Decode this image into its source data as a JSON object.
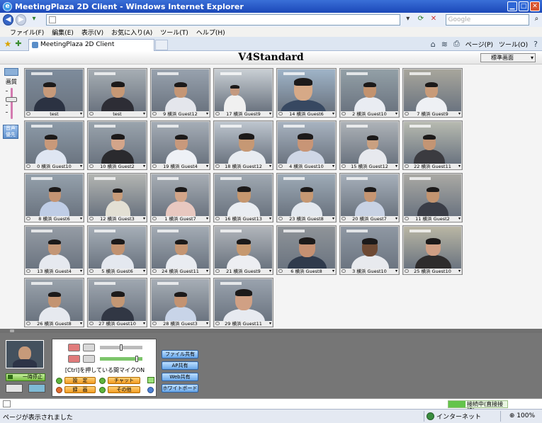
{
  "window": {
    "title": "MeetingPlaza 2D Client - Windows Internet Explorer",
    "ie_glyph": "e"
  },
  "address": {
    "url": "",
    "search_placeholder": "Google"
  },
  "menu": [
    "ファイル(F)",
    "編集(E)",
    "表示(V)",
    "お気に入り(A)",
    "ツール(T)",
    "ヘルプ(H)"
  ],
  "tab": {
    "label": "MeetingPlaza 2D Client"
  },
  "commandbar": {
    "page": "ページ(P)",
    "tools": "ツール(O)"
  },
  "app": {
    "title": "V4Standard",
    "view_mode": "標準画面",
    "quality_label": "画質",
    "audio_button": [
      "音声",
      "優先"
    ]
  },
  "participants": [
    {
      "label": "test",
      "bg": "#7e8c9c",
      "face": "#c79a7a",
      "shirt": "#2b3242",
      "x": 0.42,
      "hs": 1.0
    },
    {
      "label": "test",
      "bg": "#a7aeb4",
      "face": "#c69875",
      "shirt": "#2d2d35",
      "x": 0.5,
      "hs": 1.05
    },
    {
      "label": "9 横浜  Guest12",
      "bg": "#98a2ae",
      "face": "#c59675",
      "shirt": "#e4e6ec",
      "x": 0.5,
      "hs": 1.0
    },
    {
      "label": "17 横浜  Guest9",
      "bg": "#c9cfd4",
      "face": "#c49a80",
      "shirt": "#f0f0f0",
      "x": 0.35,
      "hs": 0.7
    },
    {
      "label": "14 横浜  Guest6",
      "bg": "#9fb4c8",
      "face": "#d6a987",
      "shirt": "#374861",
      "x": 0.45,
      "hs": 1.45
    },
    {
      "label": "2 横浜  Guest10",
      "bg": "#93a0a7",
      "face": "#c3936f",
      "shirt": "#e9ecf2",
      "x": 0.5,
      "hs": 1.0
    },
    {
      "label": "7 横浜  Guest9",
      "bg": "#a8a69c",
      "face": "#c89b79",
      "shirt": "#eef0f4",
      "x": 0.48,
      "hs": 1.0
    },
    {
      "label": "0 横浜  Guest10",
      "bg": "#8d9ba8",
      "face": "#c8997a",
      "shirt": "#dfe6f2",
      "x": 0.45,
      "hs": 1.0
    },
    {
      "label": "10 横浜  Guest2",
      "bg": "#9aa4ad",
      "face": "#d3a58a",
      "shirt": "#2a2a2e",
      "x": 0.5,
      "hs": 1.05
    },
    {
      "label": "19 横浜  Guest4",
      "bg": "#a5adb6",
      "face": "#c8997c",
      "shirt": "#eef1f6",
      "x": 0.52,
      "hs": 1.0
    },
    {
      "label": "18 横浜  Guest12",
      "bg": "#bdc5ce",
      "face": "#c69874",
      "shirt": "#e8ecf1",
      "x": 0.55,
      "hs": 1.2
    },
    {
      "label": "4 横浜  Guest10",
      "bg": "#a8b3c0",
      "face": "#c89576",
      "shirt": "#cfd7e6",
      "x": 0.48,
      "hs": 1.2
    },
    {
      "label": "15 横浜  Guest12",
      "bg": "#aeb3b8",
      "face": "#c9a080",
      "shirt": "#e7e9ee",
      "x": 0.55,
      "hs": 0.9
    },
    {
      "label": "22 横浜  Guest11",
      "bg": "#b7bab0",
      "face": "#c39574",
      "shirt": "#3b3b40",
      "x": 0.45,
      "hs": 1.0
    },
    {
      "label": "8 横浜  Guest6",
      "bg": "#95a1ac",
      "face": "#c39474",
      "shirt": "#bfcde6",
      "x": 0.5,
      "hs": 0.95
    },
    {
      "label": "12 横浜  Guest3",
      "bg": "#b3b5b2",
      "face": "#c89c7a",
      "shirt": "#e3e0d4",
      "x": 0.5,
      "hs": 0.8
    },
    {
      "label": "1 横浜  Guest7",
      "bg": "#a8aeb5",
      "face": "#d2a589",
      "shirt": "#e8c8c0",
      "x": 0.5,
      "hs": 0.95
    },
    {
      "label": "16 横浜  Guest13",
      "bg": "#a0a9b2",
      "face": "#c5976f",
      "shirt": "#e9edf2",
      "x": 0.5,
      "hs": 1.05
    },
    {
      "label": "23 横浜  Guest8",
      "bg": "#9eabb7",
      "face": "#c59873",
      "shirt": "#e3e8ef",
      "x": 0.5,
      "hs": 1.0
    },
    {
      "label": "20 横浜  Guest7",
      "bg": "#a7b0ba",
      "face": "#c59572",
      "shirt": "#c8d2e4",
      "x": 0.5,
      "hs": 0.95
    },
    {
      "label": "11 横浜  Guest2",
      "bg": "#aaa9a4",
      "face": "#c29470",
      "shirt": "#3a3d47",
      "x": 0.5,
      "hs": 1.0
    },
    {
      "label": "13 横浜  Guest4",
      "bg": "#959ca5",
      "face": "#c39676",
      "shirt": "#e6e9ef",
      "x": 0.5,
      "hs": 1.0
    },
    {
      "label": "5 横浜  Guest6",
      "bg": "#a6aeb7",
      "face": "#c19270",
      "shirt": "#e4e8ef",
      "x": 0.5,
      "hs": 1.05
    },
    {
      "label": "24 横浜  Guest11",
      "bg": "#a3abb4",
      "face": "#c49572",
      "shirt": "#e9ecf1",
      "x": 0.52,
      "hs": 1.0
    },
    {
      "label": "21 横浜  Guest9",
      "bg": "#b1b5bb",
      "face": "#c6986f",
      "shirt": "#edeef2",
      "x": 0.5,
      "hs": 1.1
    },
    {
      "label": "6 横浜  Guest8",
      "bg": "#8f9499",
      "face": "#c59072",
      "shirt": "#2f3a4c",
      "x": 0.5,
      "hs": 1.25
    },
    {
      "label": "3 横浜  Guest10",
      "bg": "#8f98a3",
      "face": "#6e4a34",
      "shirt": "#e8eaee",
      "x": 0.5,
      "hs": 1.2
    },
    {
      "label": "25 横浜  Guest10",
      "bg": "#b9b6a4",
      "face": "#cf9f84",
      "shirt": "#2e2c2c",
      "x": 0.5,
      "hs": 1.15
    },
    {
      "label": "26 横浜  Guest8",
      "bg": "#9aa3ac",
      "face": "#c39472",
      "shirt": "#e6e9ef",
      "x": 0.5,
      "hs": 1.0
    },
    {
      "label": "27 横浜  Guest10",
      "bg": "#a0a8b1",
      "face": "#c39774",
      "shirt": "#313744",
      "x": 0.5,
      "hs": 1.05
    },
    {
      "label": "28 横浜  Guest3",
      "bg": "#a7aeb6",
      "face": "#c39372",
      "shirt": "#c8d4e8",
      "x": 0.5,
      "hs": 1.0
    },
    {
      "label": "29 横浜  Guest11",
      "bg": "#9aa3ae",
      "face": "#d0a084",
      "shirt": "#e7eaf0",
      "x": 0.5,
      "hs": 1.35
    }
  ],
  "controls": {
    "pause_button": "一時停止",
    "ctrl_hint": "[Ctrl]を押している間マイクON",
    "settings": "設　定",
    "chat": "チャット",
    "record": "録　画",
    "other": "その他",
    "share_buttons": [
      "ファイル共有",
      "AP共有",
      "Web共有",
      "ホワイトボード"
    ],
    "connection": "接続中(直接接続)"
  },
  "status": {
    "message": "ページが表示されました",
    "zone": "インターネット",
    "zoom": "100%"
  }
}
